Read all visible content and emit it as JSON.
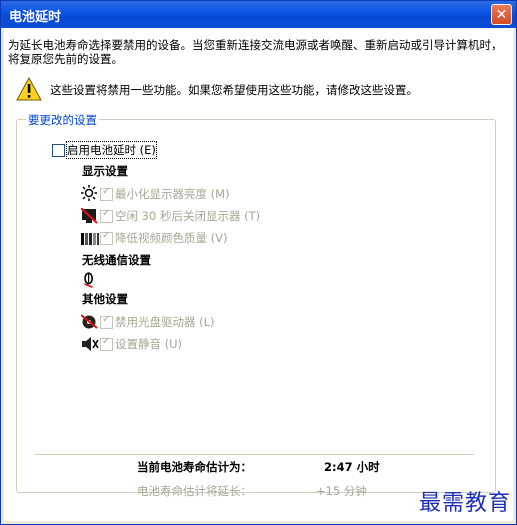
{
  "window": {
    "title": "电池延时",
    "close_glyph": "✕"
  },
  "description": "为延长电池寿命选择要禁用的设备。当您重新连接交流电源或者唤醒、重新启动或引导计算机时，将复原您先前的设置。",
  "warning": "这些设置将禁用一些功能。如果您希望使用这些功能，请修改这些设置。",
  "group_title": "要更改的设置",
  "enable_checkbox": {
    "label": "启用电池延时 (E)",
    "checked": false
  },
  "display": {
    "heading": "显示设置",
    "items": [
      {
        "label": "最小化显示器亮度 (M)",
        "icon": "brightness-icon"
      },
      {
        "label": "空闲 30 秒后关闭显示器 (T)",
        "icon": "monitor-off-icon"
      },
      {
        "label": "降低视频颜色质量 (V)",
        "icon": "color-quality-icon"
      }
    ]
  },
  "wireless": {
    "heading": "无线通信设置",
    "icon": "wireless-icon"
  },
  "other": {
    "heading": "其他设置",
    "items": [
      {
        "label": "禁用光盘驱动器 (L)",
        "icon": "disc-off-icon"
      },
      {
        "label": "设置静音 (U)",
        "icon": "mute-icon"
      }
    ]
  },
  "battery": {
    "current_label": "当前电池寿命估计为：",
    "current_value": "2:47 小时",
    "extend_label": "电池寿命估计将延长：",
    "extend_value": "+15 分钟"
  },
  "watermark": "最需教育",
  "colors": {
    "titlebar": "#0b55e6",
    "group_title": "#0046d5",
    "disabled_text": "#a6a694"
  }
}
